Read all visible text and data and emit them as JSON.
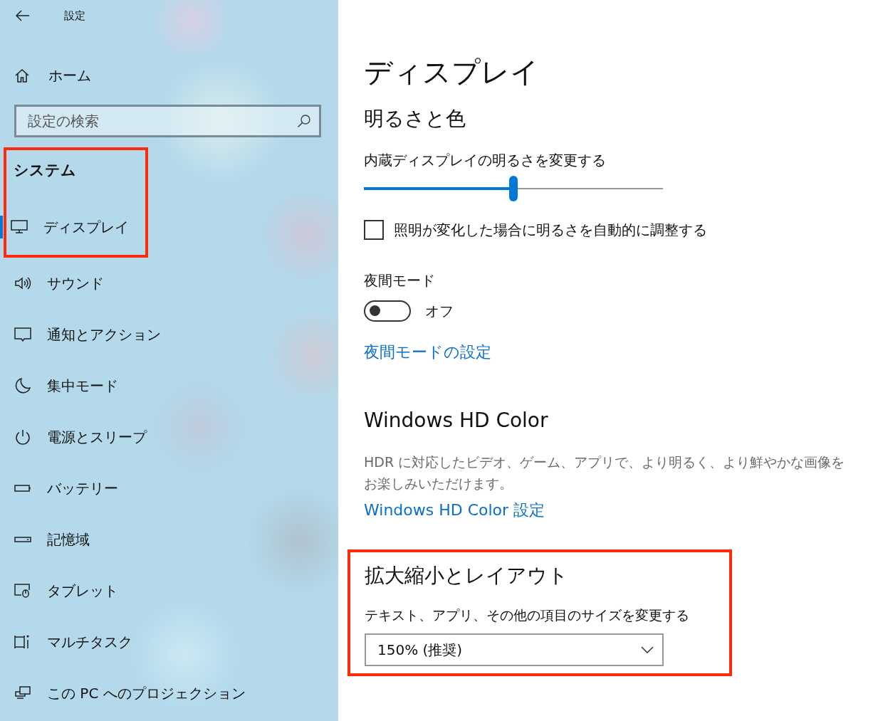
{
  "window": {
    "title": "設定"
  },
  "sidebar": {
    "home": "ホーム",
    "search": {
      "placeholder": "設定の検索"
    },
    "section": {
      "title": "システム",
      "highlighted": true
    },
    "items": [
      {
        "label": "ディスプレイ",
        "selected": true
      },
      {
        "label": "サウンド",
        "selected": false
      },
      {
        "label": "通知とアクション",
        "selected": false
      },
      {
        "label": "集中モード",
        "selected": false
      },
      {
        "label": "電源とスリープ",
        "selected": false
      },
      {
        "label": "バッテリー",
        "selected": false
      },
      {
        "label": "記憶域",
        "selected": false
      },
      {
        "label": "タブレット",
        "selected": false
      },
      {
        "label": "マルチタスク",
        "selected": false
      },
      {
        "label": "この PC へのプロジェクション",
        "selected": false
      }
    ]
  },
  "page": {
    "title": "ディスプレイ",
    "brightness": {
      "heading": "明るさと色",
      "slider": {
        "label": "内蔵ディスプレイの明るさを変更する",
        "level": 0.5
      },
      "auto_checkbox": {
        "label": "照明が変化した場合に明るさを自動的に調整する",
        "checked": false
      },
      "night_light": {
        "label": "夜間モード",
        "on": false,
        "state_text": "オフ"
      },
      "link": "夜間モードの設定"
    },
    "hdr": {
      "heading": "Windows HD Color",
      "description": "HDR に対応したビデオ、ゲーム、アプリで、より明るく、より鮮やかな画像をお楽しみいただけます。",
      "link": "Windows HD Color 設定"
    },
    "scale": {
      "heading": "拡大縮小とレイアウト",
      "highlighted": true,
      "label": "テキスト、アプリ、その他の項目のサイズを変更する",
      "dropdown": {
        "value": "150% (推奨)"
      }
    }
  }
}
